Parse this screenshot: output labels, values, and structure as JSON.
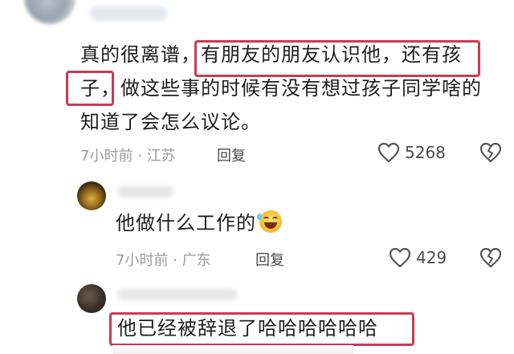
{
  "main_comment": {
    "lines": [
      "真的很离谱，有朋友的朋友认识他，还有孩",
      "子，做这些事的时候有没有想过孩子同学啥的",
      "知道了会怎么议论。"
    ],
    "time": "7小时前",
    "separator": "·",
    "location": "江苏",
    "reply_label": "回复",
    "likes": "5268"
  },
  "reply_1": {
    "text": "他做什么工作的",
    "emoji": "laughing-with-tears-emoji",
    "time": "7小时前",
    "separator": "·",
    "location": "广东",
    "reply_label": "回复",
    "likes": "429"
  },
  "reply_2": {
    "text": "他已经被辞退了哈哈哈哈哈哈"
  },
  "colors": {
    "highlight_border": "#c83c52",
    "meta_gray": "#9b9b9b",
    "text_dark": "#1e1e1e"
  }
}
